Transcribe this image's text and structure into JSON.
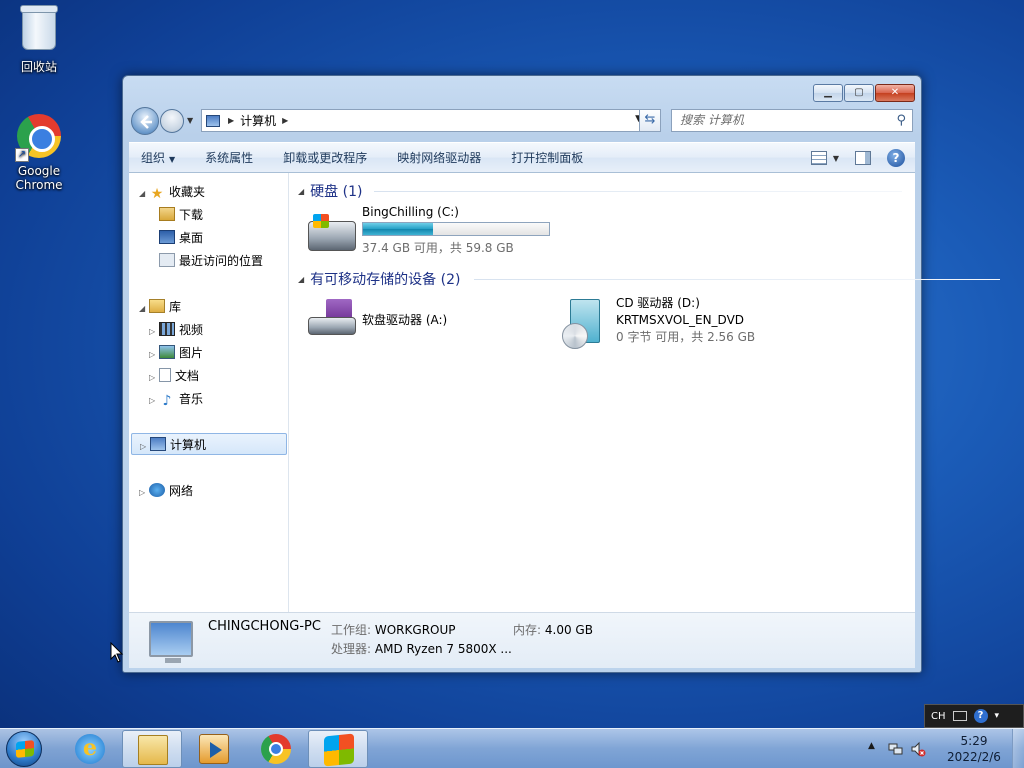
{
  "desktop": {
    "icons": [
      {
        "label": "回收站",
        "icon": "recycle-bin-icon"
      },
      {
        "label": "Google Chrome",
        "icon": "chrome-icon"
      }
    ]
  },
  "window": {
    "caption_buttons": {
      "minimize": "▁",
      "maximize": "▢",
      "close": "✕"
    },
    "address": {
      "crumbs": [
        "计算机"
      ]
    },
    "search": {
      "placeholder": "搜索 计算机"
    },
    "commands": {
      "organize": "组织",
      "system_properties": "系统属性",
      "uninstall": "卸载或更改程序",
      "map_drive": "映射网络驱动器",
      "control_panel": "打开控制面板"
    },
    "nav": {
      "favorites": "收藏夹",
      "downloads": "下载",
      "desktop": "桌面",
      "recent": "最近访问的位置",
      "libraries": "库",
      "videos": "视频",
      "pictures": "图片",
      "documents": "文档",
      "music": "音乐",
      "computer": "计算机",
      "network": "网络"
    },
    "groups": {
      "hard_disks": "硬盘 (1)",
      "removable": "有可移动存储的设备 (2)"
    },
    "drives": {
      "c": {
        "name": "BingChilling (C:)",
        "free": "37.4 GB 可用，共 59.8 GB",
        "used_fraction": 0.375
      },
      "a": {
        "name": "软盘驱动器 (A:)"
      },
      "d": {
        "name": "CD 驱动器 (D:)",
        "volume": "KRTMSXVOL_EN_DVD",
        "free": "0 字节 可用，共 2.56 GB"
      }
    },
    "details": {
      "pc_name": "CHINGCHONG-PC",
      "workgroup_label": "工作组:",
      "workgroup": "WORKGROUP",
      "memory_label": "内存:",
      "memory": "4.00 GB",
      "cpu_label": "处理器:",
      "cpu": "AMD Ryzen 7 5800X ..."
    }
  },
  "taskbar": {
    "language": "CH",
    "clock_time": "5:29",
    "clock_date": "2022/2/6",
    "pinned": [
      "ie-icon",
      "explorer-icon",
      "media-player-icon",
      "chrome-icon",
      "setup-icon"
    ]
  }
}
